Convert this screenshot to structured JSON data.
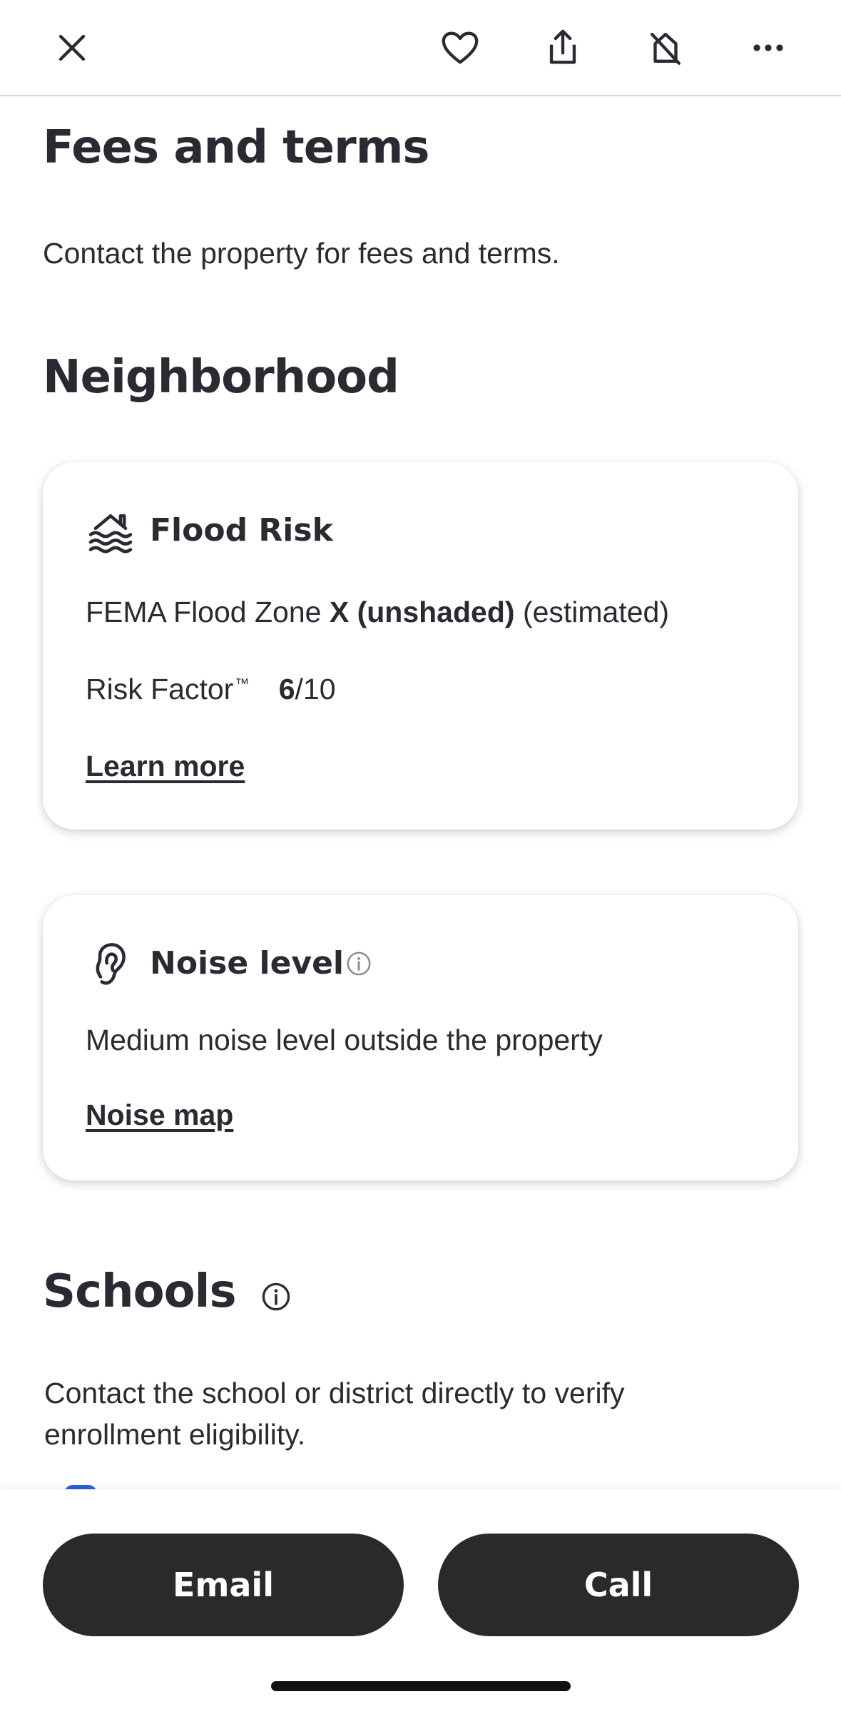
{
  "toolbar": {
    "icons": [
      "close-icon",
      "heart-icon",
      "share-icon",
      "hide-home-icon",
      "more-icon"
    ]
  },
  "fees": {
    "title": "Fees and terms",
    "text": "Contact the property for fees and terms."
  },
  "neighborhood": {
    "title": "Neighborhood",
    "flood": {
      "title": "Flood Risk",
      "zone_label": "FEMA Flood Zone",
      "zone_value": "X (unshaded)",
      "zone_note": "(estimated)",
      "risk_label": "Risk Factor",
      "risk_tm": "™",
      "risk_value": "6",
      "risk_max": "/10",
      "link": "Learn more"
    },
    "noise": {
      "title": "Noise level",
      "text": "Medium noise level outside the property",
      "link": "Noise map"
    }
  },
  "schools": {
    "title": "Schools",
    "text_line1": "Contact the school or district directly to verify",
    "text_line2": "enrollment eligibility."
  },
  "actions": {
    "email": "Email",
    "call": "Call"
  },
  "colors": {
    "text": "#2a2a33",
    "button": "#2a2a2d",
    "divider": "#d6d6d6"
  }
}
